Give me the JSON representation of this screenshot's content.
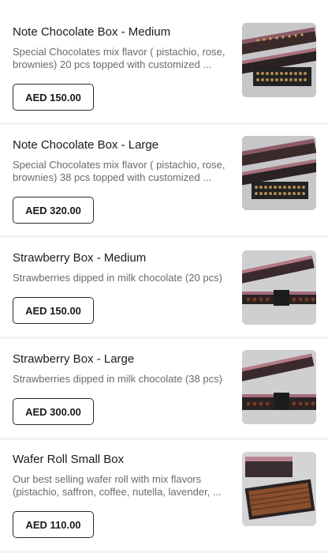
{
  "products": [
    {
      "title": "Note Chocolate Box - Medium",
      "description": "Special Chocolates mix flavor ( pistachio, rose, brownies) 20 pcs  topped with customized ...",
      "price": "AED 150.00",
      "image": "chocolate-box-image"
    },
    {
      "title": "Note Chocolate Box - Large",
      "description": "Special Chocolates mix flavor ( pistachio, rose, brownies) 38 pcs  topped with customized ...",
      "price": "AED 320.00",
      "image": "chocolate-box-image"
    },
    {
      "title": "Strawberry Box - Medium",
      "description": "Strawberries dipped in milk chocolate (20 pcs)",
      "price": "AED 150.00",
      "image": "strawberry-box-image"
    },
    {
      "title": "Strawberry Box - Large",
      "description": "Strawberries dipped in milk chocolate (38 pcs)",
      "price": "AED 300.00",
      "image": "strawberry-box-image"
    },
    {
      "title": "Wafer Roll Small Box",
      "description": "Our best selling wafer roll with mix flavors (pistachio, saffron, coffee, nutella, lavender, ...",
      "price": "AED 110.00",
      "image": "wafer-roll-box-image"
    }
  ]
}
